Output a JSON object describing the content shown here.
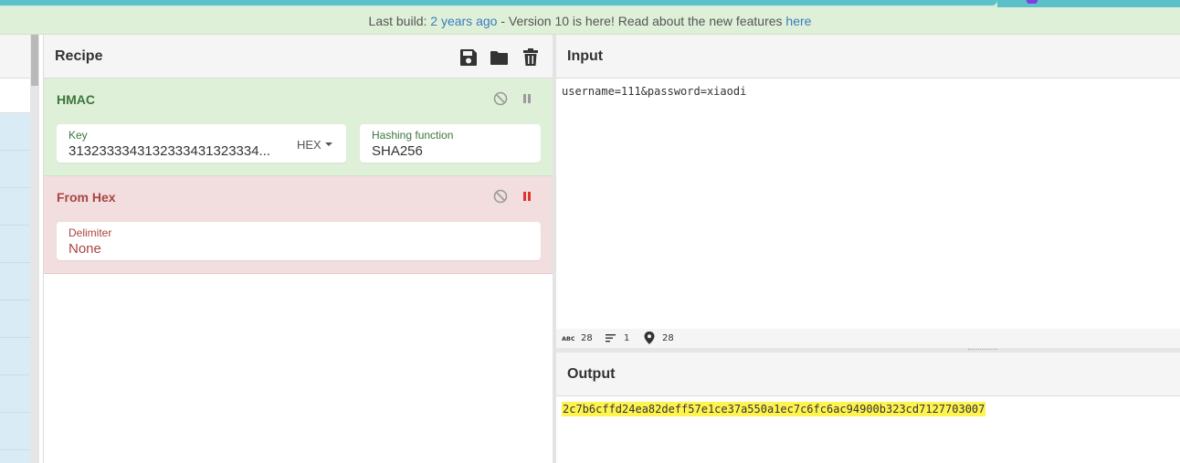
{
  "banner": {
    "prefix": "Last build: ",
    "build_age": "2 years ago",
    "middle": " - Version 10 is here! Read about the new features ",
    "link": "here"
  },
  "recipe": {
    "title": "Recipe",
    "icons": [
      "save-icon",
      "folder-open-icon",
      "trash-icon"
    ],
    "operations": [
      {
        "name": "HMAC",
        "key_label": "Key",
        "key_value": "3132333343132333431323334...",
        "key_format": "HEX",
        "hash_label": "Hashing function",
        "hash_value": "SHA256"
      },
      {
        "name": "From Hex",
        "delimiter_label": "Delimiter",
        "delimiter_value": "None"
      }
    ]
  },
  "input": {
    "title": "Input",
    "text": "username=111&password=xiaodi",
    "status": {
      "chars": "28",
      "lines": "1",
      "position": "28"
    }
  },
  "output": {
    "title": "Output",
    "text": "2c7b6cffd24ea82deff57e1ce37a550a1ec7c6fc6ac94900b323cd7127703007"
  },
  "colors": {
    "banner_bg": "#dff0d8",
    "hmac_bg": "#dff0d8",
    "fromhex_bg": "#f2dede",
    "output_highlight": "#fff350",
    "link": "#3a7bbf"
  }
}
